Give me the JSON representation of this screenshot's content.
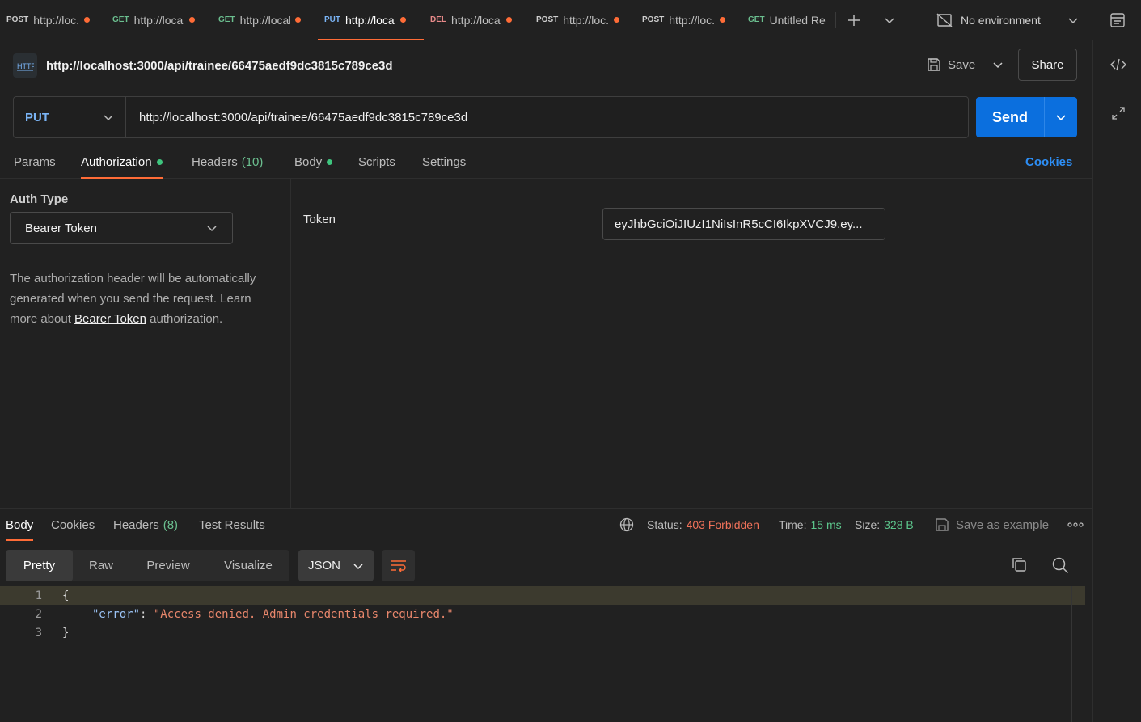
{
  "tabs": [
    {
      "method": "POST",
      "url": "http://loc."
    },
    {
      "method": "GET",
      "url": "http://local"
    },
    {
      "method": "GET",
      "url": "http://local"
    },
    {
      "method": "PUT",
      "url": "http://local"
    },
    {
      "method": "DEL",
      "url": "http://local"
    },
    {
      "method": "POST",
      "url": "http://loc."
    },
    {
      "method": "POST",
      "url": "http://loc."
    },
    {
      "method": "GET",
      "url": "Untitled Re"
    }
  ],
  "environment": {
    "label": "No environment"
  },
  "request": {
    "name": "http://localhost:3000/api/trainee/66475aedf9dc3815c789ce3d",
    "save_label": "Save",
    "share_label": "Share",
    "method": "PUT",
    "url": "http://localhost:3000/api/trainee/66475aedf9dc3815c789ce3d",
    "send_label": "Send"
  },
  "request_tabs": {
    "params": "Params",
    "authorization": "Authorization",
    "headers": "Headers",
    "headers_count": "(10)",
    "body": "Body",
    "scripts": "Scripts",
    "settings": "Settings",
    "cookies": "Cookies"
  },
  "auth": {
    "type_label": "Auth Type",
    "type_value": "Bearer Token",
    "desc_before": "The authorization header will be automatically generated when you send the request. Learn more about ",
    "desc_link": "Bearer Token",
    "desc_after": " authorization.",
    "token_label": "Token",
    "token_value": "eyJhbGciOiJIUzI1NiIsInR5cCI6IkpXVCJ9.ey..."
  },
  "response": {
    "tabs": {
      "body": "Body",
      "cookies": "Cookies",
      "headers": "Headers",
      "headers_count": "(8)",
      "test_results": "Test Results"
    },
    "status_label": "Status:",
    "status_value": "403 Forbidden",
    "time_label": "Time:",
    "time_value": "15 ms",
    "size_label": "Size:",
    "size_value": "328 B",
    "save_example": "Save as example",
    "views": [
      "Pretty",
      "Raw",
      "Preview",
      "Visualize"
    ],
    "format": "JSON",
    "code": {
      "line_numbers": [
        "1",
        "2",
        "3"
      ],
      "open_brace": "{",
      "key": "\"error\"",
      "colon": ": ",
      "value": "\"Access denied. Admin credentials required.\"",
      "close_brace": "}"
    }
  },
  "colors": {
    "accent": "#ff6c37",
    "send": "#0b6fde",
    "status_error": "#f0725a",
    "ok_green": "#5cc58b"
  }
}
